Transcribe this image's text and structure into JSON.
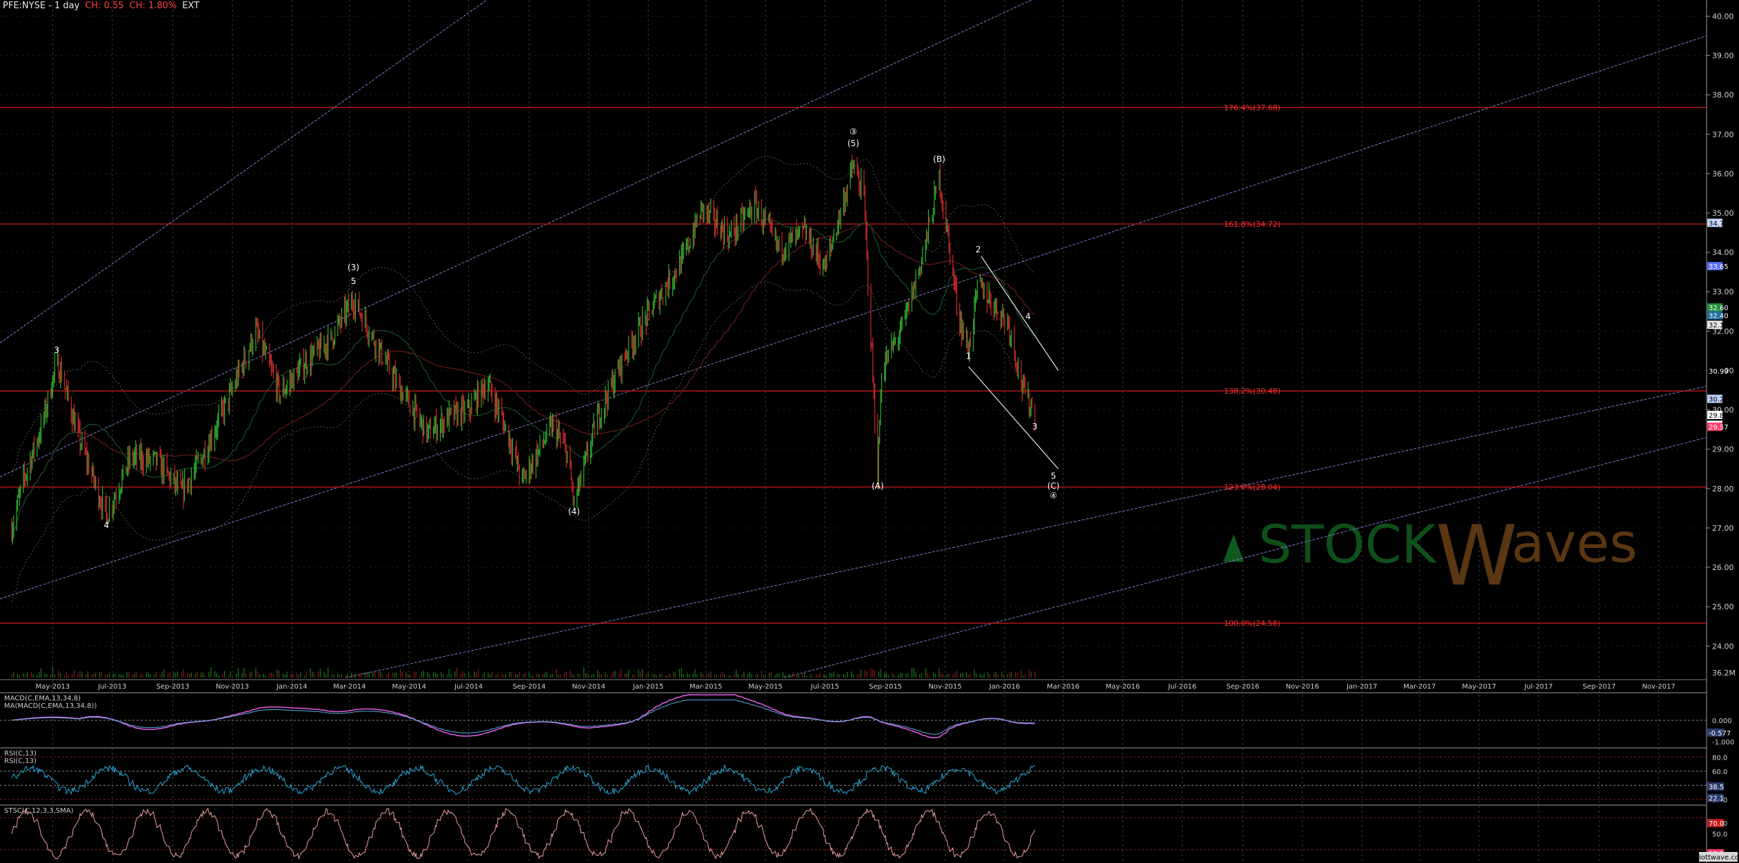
{
  "header": {
    "symbol_interval": "PFE:NYSE - 1 day",
    "change_1": "CH: 0.55",
    "change_2": "CH: 1.80%",
    "session": "EXT"
  },
  "watermark": {
    "stock": "STOCK",
    "w": "W",
    "aves": "aves"
  },
  "credit": "elliottwave.com",
  "colors": {
    "background": "#000000",
    "up_candle": "#2fb32f",
    "down_candle": "#d02a2a",
    "fib_line": "#c01a1a",
    "channel_line": "#7f7fd0",
    "wave_label": "#ffffff",
    "macd_line": "#e860e8",
    "rsi_line": "#2aa8d8",
    "stoch_k": "#f0a0a0"
  },
  "chart_data": {
    "type": "candlestick",
    "price_axis": {
      "ylim": [
        23.2,
        40.2
      ],
      "ticks": [
        "24.00",
        "25.00",
        "26.00",
        "27.00",
        "28.00",
        "29.00",
        "30.00",
        "31.00",
        "32.00",
        "33.00",
        "34.00",
        "35.00",
        "36.00",
        "37.00",
        "38.00",
        "39.00",
        "40.00"
      ]
    },
    "x_axis_labels": [
      "May-2013",
      "Jul-2013",
      "Sep-2013",
      "Nov-2013",
      "Jan-2014",
      "Mar-2014",
      "May-2014",
      "Jul-2014",
      "Sep-2014",
      "Nov-2014",
      "Jan-2015",
      "Mar-2015",
      "May-2015",
      "Jul-2015",
      "Sep-2015",
      "Nov-2015",
      "Jan-2016",
      "Mar-2016",
      "May-2016",
      "Jul-2016",
      "Sep-2016",
      "Nov-2016",
      "Jan-2017",
      "Mar-2017",
      "May-2017",
      "Jul-2017",
      "Sep-2017",
      "Nov-2017"
    ],
    "price_path": [
      [
        "2013-03-20",
        27.0
      ],
      [
        "2013-04-01",
        28.2
      ],
      [
        "2013-04-20",
        29.6
      ],
      [
        "2013-05-05",
        31.2
      ],
      [
        "2013-05-10",
        30.9
      ],
      [
        "2013-05-25",
        29.5
      ],
      [
        "2013-06-15",
        28.0
      ],
      [
        "2013-06-25",
        27.3
      ],
      [
        "2013-07-20",
        28.8
      ],
      [
        "2013-08-15",
        28.7
      ],
      [
        "2013-09-10",
        27.9
      ],
      [
        "2013-10-01",
        28.8
      ],
      [
        "2013-11-01",
        30.5
      ],
      [
        "2013-11-25",
        32.0
      ],
      [
        "2013-12-20",
        30.4
      ],
      [
        "2014-01-15",
        31.2
      ],
      [
        "2014-02-10",
        31.8
      ],
      [
        "2014-03-05",
        32.8
      ],
      [
        "2014-04-01",
        31.5
      ],
      [
        "2014-04-20",
        30.6
      ],
      [
        "2014-05-20",
        29.4
      ],
      [
        "2014-06-10",
        29.8
      ],
      [
        "2014-07-01",
        30.0
      ],
      [
        "2014-07-20",
        30.7
      ],
      [
        "2014-08-10",
        29.4
      ],
      [
        "2014-08-25",
        28.2
      ],
      [
        "2014-09-25",
        29.6
      ],
      [
        "2014-10-10",
        28.9
      ],
      [
        "2014-10-17",
        27.6
      ],
      [
        "2014-11-10",
        29.8
      ],
      [
        "2014-12-10",
        31.5
      ],
      [
        "2015-01-10",
        32.8
      ],
      [
        "2015-02-05",
        33.8
      ],
      [
        "2015-02-25",
        35.1
      ],
      [
        "2015-03-25",
        34.4
      ],
      [
        "2015-04-20",
        35.2
      ],
      [
        "2015-05-15",
        34.1
      ],
      [
        "2015-06-10",
        34.5
      ],
      [
        "2015-07-01",
        33.6
      ],
      [
        "2015-07-30",
        36.2
      ],
      [
        "2015-08-10",
        35.4
      ],
      [
        "2015-08-24",
        28.3
      ],
      [
        "2015-08-28",
        31.0
      ],
      [
        "2015-09-20",
        32.2
      ],
      [
        "2015-10-10",
        34.0
      ],
      [
        "2015-10-26",
        35.9
      ],
      [
        "2015-11-05",
        34.2
      ],
      [
        "2015-11-15",
        32.4
      ],
      [
        "2015-11-25",
        31.5
      ],
      [
        "2015-12-05",
        33.2
      ],
      [
        "2015-12-20",
        32.7
      ],
      [
        "2016-01-05",
        32.2
      ],
      [
        "2016-01-20",
        30.5
      ],
      [
        "2016-02-01",
        29.9
      ]
    ],
    "last_close": 29.6,
    "fib_levels": [
      {
        "label": "176.4%(37.68)",
        "value": 37.68
      },
      {
        "label": "161.8%(34.72)",
        "value": 34.72
      },
      {
        "label": "138.2%(30.48)",
        "value": 30.48
      },
      {
        "label": "123.6%(28.04)",
        "value": 28.04
      },
      {
        "label": "100.0%(24.58)",
        "value": 24.58
      }
    ],
    "price_tags": [
      {
        "label": "34.75",
        "value": 34.75,
        "color": "#c7d7ff",
        "text_color": "#000000"
      },
      {
        "label": "33.65",
        "value": 33.65,
        "color": "#5b6dff",
        "text_color": "#ffffff"
      },
      {
        "label": "32.60",
        "value": 32.6,
        "color": "#1f8f3a",
        "text_color": "#ffffff"
      },
      {
        "label": "32.40",
        "value": 32.4,
        "color": "#1f6f9f",
        "text_color": "#ffffff"
      },
      {
        "label": "32.16",
        "value": 32.16,
        "color": "#e8e8e8",
        "text_color": "#000000"
      },
      {
        "label": "30.99",
        "value": 30.99,
        "color": "#000000",
        "text_color": "#ffffff"
      },
      {
        "label": "30.28",
        "value": 30.28,
        "color": "#bcd0ff",
        "text_color": "#000000"
      },
      {
        "label": "29.87",
        "value": 29.87,
        "color": "#ffffff",
        "text_color": "#000000"
      },
      {
        "label": "29.62",
        "value": 29.62,
        "color": "#ffffff",
        "text_color": "#000000"
      },
      {
        "label": "29.57",
        "value": 29.57,
        "color": "#ff3b6b",
        "text_color": "#ffffff"
      }
    ],
    "volume_readout": "36.2M",
    "wave_labels": [
      {
        "text": "3",
        "date": "2013-05-05",
        "value": 31.45
      },
      {
        "text": "4",
        "date": "2013-06-25",
        "value": 27.0
      },
      {
        "text": "(3)",
        "date": "2014-03-05",
        "value": 33.55
      },
      {
        "text": "5",
        "date": "2014-03-05",
        "value": 33.2
      },
      {
        "text": "(4)",
        "date": "2014-10-17",
        "value": 27.35
      },
      {
        "text": "③",
        "date": "2015-07-30",
        "value": 37.0
      },
      {
        "text": "(5)",
        "date": "2015-07-30",
        "value": 36.7
      },
      {
        "text": "(A)",
        "date": "2015-08-24",
        "value": 28.0
      },
      {
        "text": "(B)",
        "date": "2015-10-26",
        "value": 36.3
      },
      {
        "text": "2",
        "date": "2015-12-05",
        "value": 34.0
      },
      {
        "text": "1",
        "date": "2015-11-25",
        "value": 31.3
      },
      {
        "text": "4",
        "date": "2016-01-25",
        "value": 32.3
      },
      {
        "text": "3",
        "date": "2016-02-01",
        "value": 29.5
      },
      {
        "text": "5",
        "date": "2016-02-20",
        "value": 28.25
      },
      {
        "text": "(C)",
        "date": "2016-02-20",
        "value": 28.0
      },
      {
        "text": "④",
        "date": "2016-02-20",
        "value": 27.75
      }
    ],
    "indicators": [
      {
        "name": "MACD",
        "labels": [
          "MACD(C,EMA,13,34,8)",
          "MA(MACD(C,EMA,13,34,8))"
        ],
        "ylim": [
          -1.2,
          1.2
        ],
        "ticks": [
          "0.000",
          "-1.000"
        ],
        "readouts": [
          {
            "label": "-0.577",
            "value": -0.577
          }
        ]
      },
      {
        "name": "RSI",
        "labels": [
          "RSI(C,13)",
          "RSI(C,13)"
        ],
        "ylim": [
          15,
          90
        ],
        "ticks": [
          "80.0",
          "60.0",
          "20.0"
        ],
        "levels": [
          80,
          60,
          40,
          20
        ],
        "readouts": [
          {
            "label": "38.5",
            "value": 38.5
          },
          {
            "label": "22.1",
            "value": 22.1
          }
        ]
      },
      {
        "name": "Stochastic",
        "labels": [
          "STSC(C,12,3,3,SMA)"
        ],
        "ylim": [
          0,
          100
        ],
        "ticks": [
          "70.0",
          "50.0"
        ],
        "levels": [
          80,
          20
        ],
        "readouts": [
          {
            "label": "70.0",
            "value": 70.0
          },
          {
            "label": "13.1",
            "value": 13.1
          }
        ]
      }
    ]
  }
}
